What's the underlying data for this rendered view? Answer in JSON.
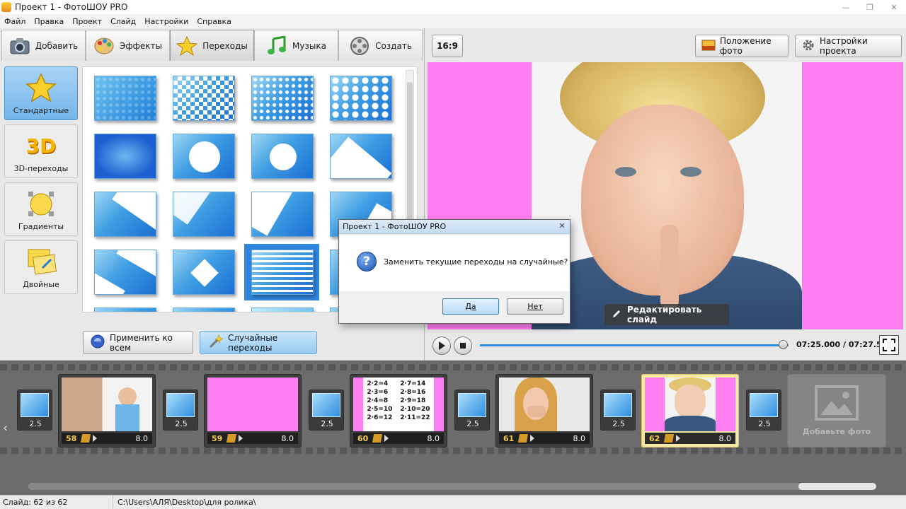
{
  "window": {
    "title": "Проект 1 - ФотоШОУ PRO",
    "icon_text": "PRO"
  },
  "menu": [
    "Файл",
    "Правка",
    "Проект",
    "Слайд",
    "Настройки",
    "Справка"
  ],
  "tabs": [
    {
      "label": "Добавить",
      "icon": "camera-icon"
    },
    {
      "label": "Эффекты",
      "icon": "palette-icon"
    },
    {
      "label": "Переходы",
      "icon": "star-icon",
      "active": true
    },
    {
      "label": "Музыка",
      "icon": "music-note-icon"
    },
    {
      "label": "Создать",
      "icon": "film-reel-icon"
    }
  ],
  "categories": [
    {
      "label": "Стандартные",
      "icon": "star-icon",
      "active": true
    },
    {
      "label": "3D-переходы",
      "icon": "3d-icon",
      "icon_text": "3D"
    },
    {
      "label": "Градиенты",
      "icon": "gradient-icon"
    },
    {
      "label": "Двойные",
      "icon": "double-icon"
    }
  ],
  "buttons": {
    "apply_all": "Применить ко всем",
    "random": "Случайные переходы",
    "ratio": "16:9",
    "photo_position": "Положение фото",
    "project_settings": "Настройки проекта",
    "edit_slide": "Редактировать слайд",
    "add_photo": "Добавьте фото"
  },
  "player": {
    "time": "07:25.000 / 07:27.500",
    "progress": 0.985
  },
  "timeline": {
    "items": [
      {
        "type": "transition",
        "duration": "2.5"
      },
      {
        "type": "slide",
        "number": "58",
        "duration": "8.0",
        "image": "child-standing"
      },
      {
        "type": "transition",
        "duration": "2.5"
      },
      {
        "type": "slide",
        "number": "59",
        "duration": "8.0",
        "image": "pink-blank"
      },
      {
        "type": "transition",
        "duration": "2.5"
      },
      {
        "type": "slide",
        "number": "60",
        "duration": "8.0",
        "image": "math-worksheet"
      },
      {
        "type": "transition",
        "duration": "2.5"
      },
      {
        "type": "slide",
        "number": "61",
        "duration": "8.0",
        "image": "woman-surprised"
      },
      {
        "type": "transition",
        "duration": "2.5"
      },
      {
        "type": "slide",
        "number": "62",
        "duration": "8.0",
        "image": "boy-shh",
        "selected": true
      },
      {
        "type": "transition",
        "duration": "2.5"
      }
    ],
    "worksheet_lines": [
      "2·2=4",
      "2·3=6",
      "2·4=8",
      "2·5=10",
      "2·6=12",
      "2·7=14",
      "2·8=16",
      "2·9=18",
      "2·10=20",
      "2·11=22"
    ]
  },
  "status": {
    "slide": "Слайд: 62 из 62",
    "path": "C:\\Users\\АЛЯ\\Desktop\\для ролика\\"
  },
  "dialog": {
    "title": "Проект 1 - ФотоШОУ PRO",
    "message": "Заменить текущие переходы на случайные?",
    "yes": "Да",
    "no": "Нет",
    "icon": "question-icon"
  },
  "colors": {
    "accent": "#2f86dc",
    "preview_background": "#ff7ff3",
    "selected_slide": "#f5e7a5"
  }
}
